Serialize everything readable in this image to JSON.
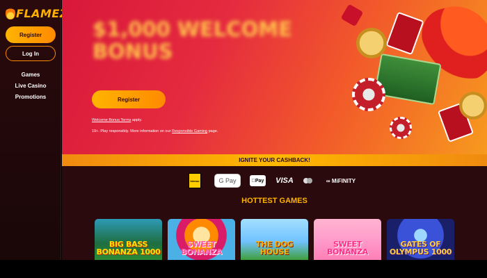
{
  "brand": {
    "logo": "FLAMEZ"
  },
  "sidebar": {
    "register_label": "Register",
    "login_label": "Log In",
    "nav": [
      {
        "label": "Games"
      },
      {
        "label": "Live Casino"
      },
      {
        "label": "Promotions"
      }
    ]
  },
  "hero": {
    "title": "$1,000 WELCOME BONUS",
    "subtitle": "",
    "register_label": "Register",
    "terms_link": "Welcome Bonus Terms",
    "terms_suffix": " apply.",
    "resp_prefix": "19+. Play responsibly. More information on our ",
    "resp_link": "Responsible Gaming",
    "resp_suffix": " page."
  },
  "cashback": {
    "label": "IGNITE YOUR CASHBACK!"
  },
  "payments": {
    "interac": "Interac",
    "gpay": "G Pay",
    "applepay": "Pay",
    "visa": "VISA",
    "mifinity": "MiFINITY"
  },
  "hottest": {
    "title": "HOTTEST GAMES"
  },
  "games": [
    {
      "title": "BIG BASS BONANZA 1000"
    },
    {
      "title": "SWEET BONANZA"
    },
    {
      "title": "THE DOG HOUSE"
    },
    {
      "title": "SWEET BONANZA"
    },
    {
      "title": "GATES OF OLYMPUS 1000"
    }
  ],
  "colors": {
    "accent": "#ffb400",
    "hero_start": "#d9183a",
    "hero_end": "#f79a1e",
    "sidebar_bg": "#2a0a0c"
  }
}
